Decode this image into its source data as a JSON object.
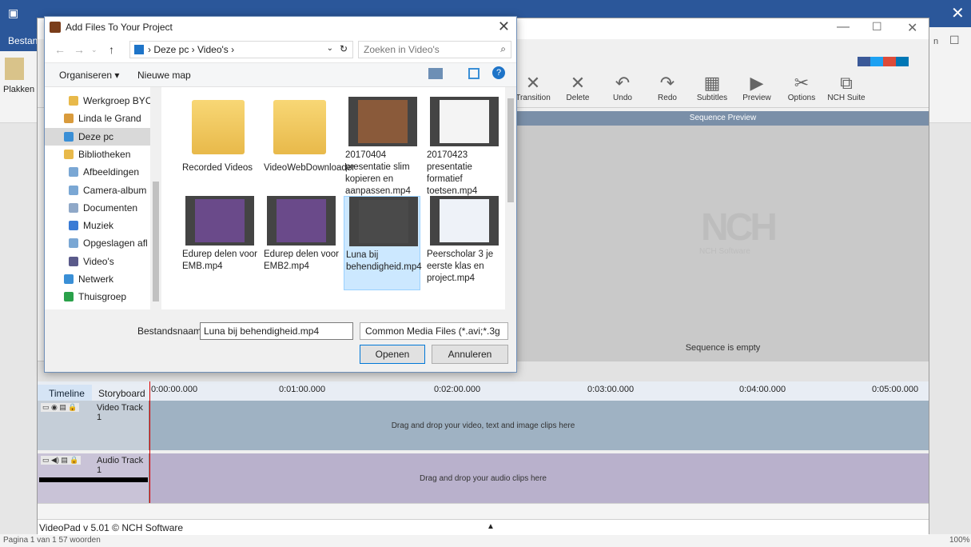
{
  "word": {
    "bestand_label": "Bestan",
    "plakken_label": "Plakken",
    "status_left": "Pagina 1 van 1   57 woorden",
    "zoom": "100%"
  },
  "videopad": {
    "toolbar": [
      {
        "label": "Transition",
        "icon": "transition-icon"
      },
      {
        "label": "Delete",
        "icon": "delete-icon"
      },
      {
        "label": "Undo",
        "icon": "undo-icon"
      },
      {
        "label": "Redo",
        "icon": "redo-icon"
      },
      {
        "label": "Subtitles",
        "icon": "subtitles-icon"
      },
      {
        "label": "Preview",
        "icon": "preview-icon"
      },
      {
        "label": "Options",
        "icon": "options-icon"
      },
      {
        "label": "NCH Suite",
        "icon": "nch-suite-icon"
      }
    ],
    "preview_title": "Sequence Preview",
    "logo_text": "NCH",
    "logo_sub": "NCH Software",
    "sequence_empty": "Sequence is empty",
    "tabs": {
      "timeline": "Timeline",
      "storyboard": "Storyboard"
    },
    "ruler": [
      "0:00:00.000",
      "0:01:00.000",
      "0:02:00.000",
      "0:03:00.000",
      "0:04:00.000",
      "0:05:00.000"
    ],
    "video_track": {
      "name": "Video Track 1",
      "hint": "Drag and drop your video, text and image clips here"
    },
    "audio_track": {
      "name": "Audio Track 1",
      "hint": "Drag and drop your audio clips here"
    },
    "status": "VideoPad v 5.01 © NCH Software"
  },
  "dialog": {
    "title": "Add Files To Your Project",
    "breadcrumb": "›  Deze pc  ›  Video's  ›",
    "search_placeholder": "Zoeken in Video's",
    "organize": "Organiseren ▾",
    "new_folder": "Nieuwe map",
    "sidebar": [
      {
        "label": "Werkgroep BYC",
        "color": "#e8b94a"
      },
      {
        "label": "Linda le Grand",
        "color": "#d99b3c"
      },
      {
        "label": "Deze pc",
        "color": "#3a8fd6"
      },
      {
        "label": "Bibliotheken",
        "color": "#e8b94a"
      },
      {
        "label": "Afbeeldingen",
        "color": "#7aa7d4"
      },
      {
        "label": "Camera-album",
        "color": "#7aa7d4"
      },
      {
        "label": "Documenten",
        "color": "#8fa8c8"
      },
      {
        "label": "Muziek",
        "color": "#3a7bd5"
      },
      {
        "label": "Opgeslagen afl",
        "color": "#7aa7d4"
      },
      {
        "label": "Video's",
        "color": "#5a5a8a"
      },
      {
        "label": "Netwerk",
        "color": "#3a8fd6"
      },
      {
        "label": "Thuisgroep",
        "color": "#2aa14a"
      }
    ],
    "files": [
      {
        "name": "Recorded Videos",
        "kind": "folder"
      },
      {
        "name": "VideoWebDownloader",
        "kind": "folder"
      },
      {
        "name": "20170404 presentatie slim kopieren en aanpassen.mp4",
        "kind": "video",
        "thumb": "#8a5a3a"
      },
      {
        "name": "20170423 presentatie formatief toetsen.mp4",
        "kind": "video",
        "thumb": "#f4f4f4"
      },
      {
        "name": "Edurep delen voor EMB.mp4",
        "kind": "video",
        "thumb": "#6a4a8a"
      },
      {
        "name": "Edurep delen voor EMB2.mp4",
        "kind": "video",
        "thumb": "#6a4a8a"
      },
      {
        "name": "Luna bij behendigheid.mp4",
        "kind": "video",
        "thumb": "#4a4a4a",
        "selected": true
      },
      {
        "name": "Peerscholar 3 je eerste klas en project.mp4",
        "kind": "video",
        "thumb": "#eef2f8"
      }
    ],
    "filename_label": "Bestandsnaam:",
    "filename_value": "Luna bij behendigheid.mp4",
    "filetype": "Common Media Files (*.avi;*.3g",
    "open": "Openen",
    "cancel": "Annuleren"
  }
}
